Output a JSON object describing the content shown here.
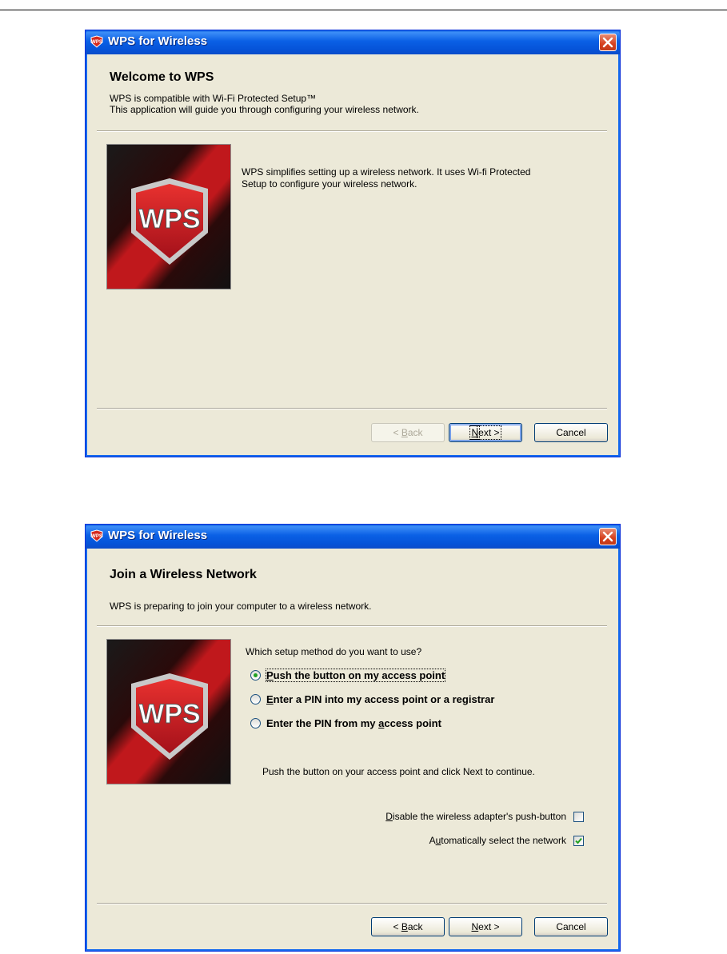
{
  "colors": {
    "titlebar": "#0a5ee0",
    "window_bg": "#ece9d8",
    "close": "#d6401e",
    "check": "#21a121"
  },
  "window1": {
    "title": "WPS for Wireless",
    "header_title": "Welcome to WPS",
    "header_sub_1": "WPS is compatible with Wi-Fi Protected Setup™",
    "header_sub_2": "This application will guide you through configuring your wireless network.",
    "banner_text": "WPS",
    "body_1": "WPS simplifies setting up a wireless network. It uses Wi-fi Protected",
    "body_2": "Setup to configure your wireless network.",
    "back_pre": "< ",
    "back_key": "B",
    "back_rest": "ack",
    "next_key": "N",
    "next_rest": "ext >",
    "cancel": "Cancel"
  },
  "window2": {
    "title": "WPS for Wireless",
    "header_title": "Join a Wireless Network",
    "header_sub": "WPS is preparing to join your computer to a wireless network.",
    "banner_text": "WPS",
    "question": "Which setup method do you want to use?",
    "options": [
      {
        "key": "P",
        "rest": "ush the button on my access point",
        "selected": true
      },
      {
        "key": "E",
        "rest": "nter a PIN into my access point or a registrar",
        "selected": false
      },
      {
        "pre": "Enter the PIN from my ",
        "key": "a",
        "rest": "ccess point",
        "selected": false
      }
    ],
    "instruction": "Push the button on your access point and click Next to continue.",
    "disable_pre": "",
    "disable_key": "D",
    "disable_rest": "isable the wireless adapter's push-button",
    "disable_checked": false,
    "auto_pre": "A",
    "auto_key": "u",
    "auto_rest": "tomatically select the network",
    "auto_checked": true,
    "back_pre": "< ",
    "back_key": "B",
    "back_rest": "ack",
    "next_key": "N",
    "next_rest": "ext >",
    "cancel": "Cancel"
  }
}
